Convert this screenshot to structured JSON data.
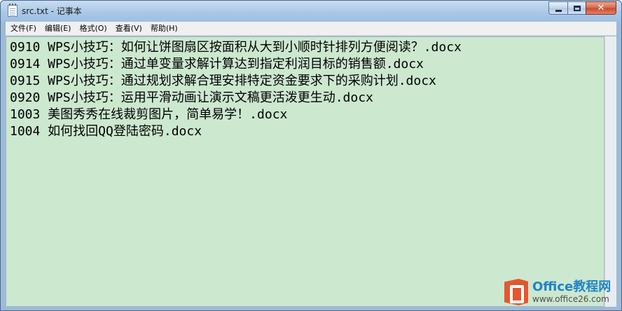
{
  "window": {
    "title": "src.txt - 记事本",
    "controls": {
      "minimize": "",
      "maximize": "",
      "close": "✕"
    }
  },
  "menu": [
    {
      "label": "文件(F)"
    },
    {
      "label": "编辑(E)"
    },
    {
      "label": "格式(O)"
    },
    {
      "label": "查看(V)"
    },
    {
      "label": "帮助(H)"
    }
  ],
  "editor": {
    "background": "#cce8cf",
    "lines": [
      "0910 WPS小技巧：如何让饼图扇区按面积从大到小顺时针排列方便阅读？.docx",
      "0914 WPS小技巧：通过单变量求解计算达到指定利润目标的销售额.docx",
      "0915 WPS小技巧：通过规划求解合理安排特定资金要求下的采购计划.docx",
      "0920 WPS小技巧：运用平滑动画让演示文稿更活泼更生动.docx",
      "1003 美图秀秀在线裁剪图片，简单易学！.docx",
      "1004 如何找回QQ登陆密码.docx"
    ]
  },
  "watermark": {
    "brand": "Office教程网",
    "url": "www.office26.com",
    "brand_color": "#1f84c7",
    "logo_color": "#e4572e"
  }
}
